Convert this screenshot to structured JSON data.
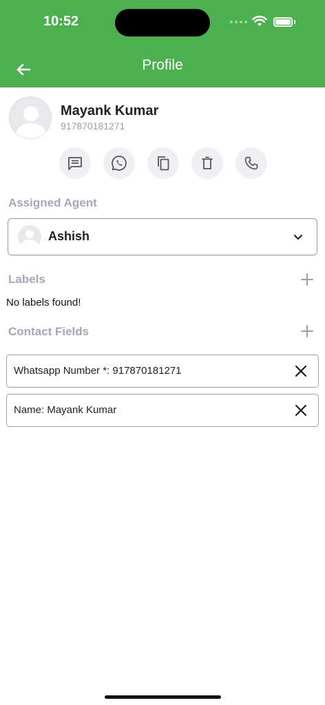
{
  "status_bar": {
    "time": "10:52"
  },
  "header": {
    "title": "Profile"
  },
  "contact": {
    "name": "Mayank Kumar",
    "phone": "917870181271"
  },
  "actions": [
    "message-icon",
    "whatsapp-icon",
    "copy-icon",
    "delete-icon",
    "phone-icon"
  ],
  "assigned_agent": {
    "label": "Assigned Agent",
    "selected": "Ashish"
  },
  "labels": {
    "label": "Labels",
    "empty_text": "No labels found!"
  },
  "contact_fields": {
    "label": "Contact Fields",
    "items": [
      {
        "text": "Whatsapp Number *: 917870181271"
      },
      {
        "text": "Name: Mayank Kumar"
      }
    ]
  },
  "colors": {
    "header_bg": "#4caf50",
    "section_label": "#a3a8b5",
    "action_bg": "#eef0f3"
  }
}
